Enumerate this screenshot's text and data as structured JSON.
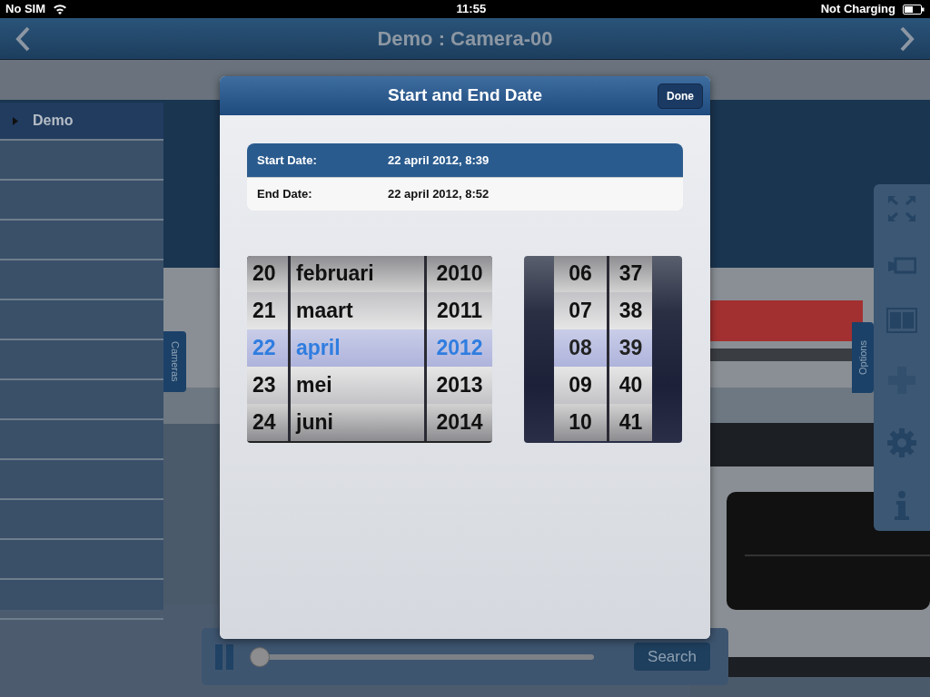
{
  "status_bar": {
    "carrier": "No SIM",
    "time": "11:55",
    "charging": "Not Charging"
  },
  "nav_bar": {
    "title": "Demo : Camera-00"
  },
  "sidebar": {
    "items": [
      {
        "label": "Demo",
        "selected": true
      }
    ]
  },
  "side_tabs": {
    "left": "Cameras",
    "right": "Options"
  },
  "modal": {
    "title": "Start and End Date",
    "done": "Done",
    "dates": [
      {
        "label": "Start Date:",
        "value": "22 april 2012, 8:39",
        "selected": true
      },
      {
        "label": "End Date:",
        "value": "22 april 2012, 8:52",
        "selected": false
      }
    ],
    "date_picker": {
      "rows": [
        {
          "day": "20",
          "month": "februari",
          "year": "2010",
          "selected": false
        },
        {
          "day": "21",
          "month": "maart",
          "year": "2011",
          "selected": false
        },
        {
          "day": "22",
          "month": "april",
          "year": "2012",
          "selected": true
        },
        {
          "day": "23",
          "month": "mei",
          "year": "2013",
          "selected": false
        },
        {
          "day": "24",
          "month": "juni",
          "year": "2014",
          "selected": false
        }
      ]
    },
    "time_picker": {
      "rows": [
        {
          "hour": "06",
          "minute": "37",
          "selected": false
        },
        {
          "hour": "07",
          "minute": "38",
          "selected": false
        },
        {
          "hour": "08",
          "minute": "39",
          "selected": true
        },
        {
          "hour": "09",
          "minute": "40",
          "selected": false
        },
        {
          "hour": "10",
          "minute": "41",
          "selected": false
        }
      ]
    }
  },
  "toolbar": {
    "tools": [
      {
        "kind": "fullscreen"
      },
      {
        "kind": "camera"
      },
      {
        "kind": "film"
      },
      {
        "kind": "dpad"
      },
      {
        "kind": "settings"
      },
      {
        "kind": "info"
      }
    ]
  },
  "playback": {
    "paused": false,
    "level": 0,
    "search": "Search"
  }
}
